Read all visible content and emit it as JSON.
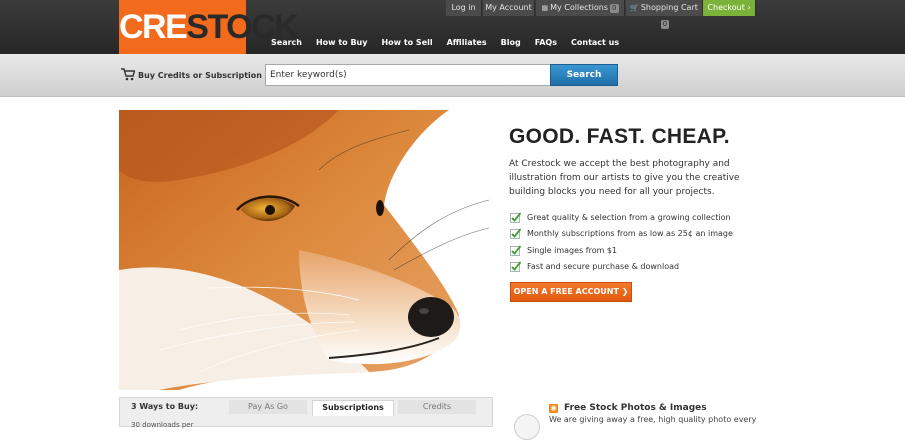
{
  "logo": {
    "part1": "CRE",
    "part2": "STOCK"
  },
  "utility": {
    "login": "Log in",
    "account": "My Account",
    "collections": "My Collections",
    "collections_count": "0",
    "cart": "Shopping Cart",
    "cart_count": "0",
    "checkout": "Checkout ›"
  },
  "nav": [
    "Search",
    "How to Buy",
    "How to Sell",
    "Affiliates",
    "Blog",
    "FAQs",
    "Contact us"
  ],
  "searchbar": {
    "buy_label": "Buy Credits or Subscription",
    "placeholder": "Enter keyword(s)",
    "button": "Search"
  },
  "hero": {
    "headline": "GOOD. FAST. CHEAP.",
    "description": "At Crestock we accept the best photography and illustration from our artists to give you the creative building blocks you need for all your projects.",
    "features": [
      "Great quality & selection from a growing collection",
      "Monthly subscriptions from as low as 25¢ an image",
      "Single images from $1",
      "Fast and secure purchase & download"
    ],
    "cta": "OPEN A FREE ACCOUNT ❯"
  },
  "buy": {
    "label": "3 Ways to Buy:",
    "tabs": [
      "Pay As Go",
      "Subscriptions",
      "Credits"
    ],
    "downloads_label": "30 downloads per"
  },
  "free": {
    "title": "Free Stock Photos & Images",
    "text": "We are giving away a free, high quality photo every"
  },
  "colors": {
    "brand_orange": "#f26a1b",
    "checkout_green": "#7bb33a",
    "search_blue": "#2a82c2"
  }
}
